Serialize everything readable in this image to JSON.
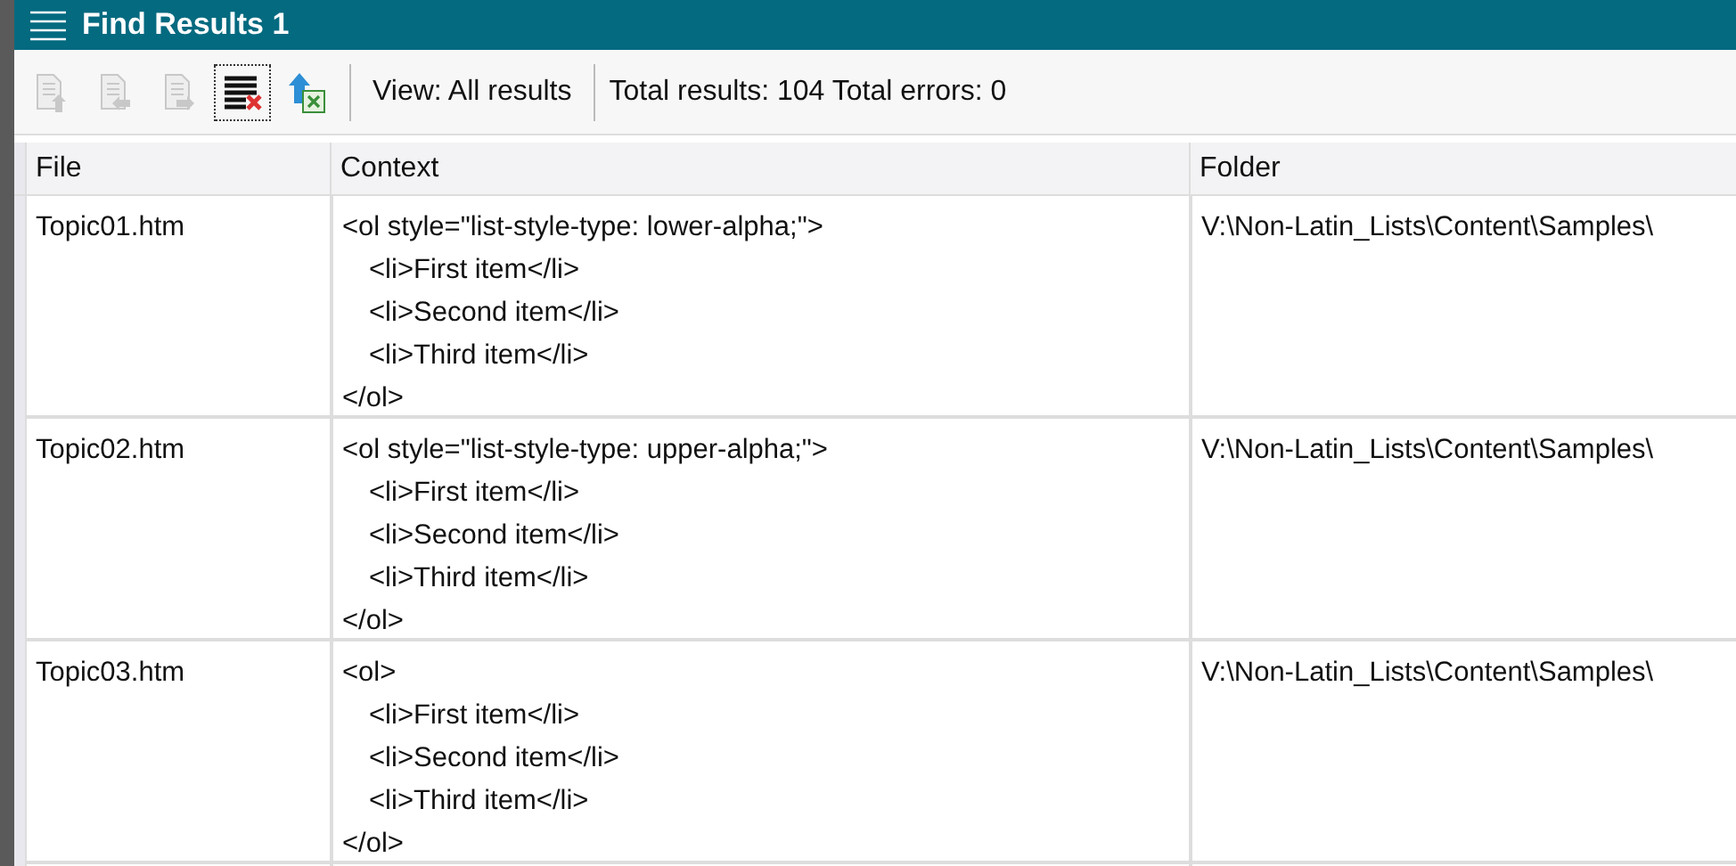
{
  "window": {
    "title": "Find Results 1"
  },
  "toolbar": {
    "buttons": [
      {
        "kind": "doc-up",
        "disabled": true,
        "focused": false
      },
      {
        "kind": "doc-left",
        "disabled": true,
        "focused": false
      },
      {
        "kind": "doc-right",
        "disabled": true,
        "focused": false
      },
      {
        "kind": "clear",
        "disabled": false,
        "focused": true
      },
      {
        "kind": "export",
        "disabled": false,
        "focused": false
      }
    ],
    "view": "View: All results",
    "summary": "Total results: 104 Total errors: 0"
  },
  "table": {
    "columns": [
      "File",
      "Context",
      "Folder"
    ],
    "rows": [
      {
        "file": "Topic01.htm",
        "context": {
          "open": "<ol style=\"list-style-type: lower-alpha;\">",
          "children": [
            "<li>First item</li>",
            "<li>Second item</li>",
            "<li>Third item</li>"
          ],
          "close": "</ol>"
        },
        "folder": "V:\\Non-Latin_Lists\\Content\\Samples\\"
      },
      {
        "file": "Topic02.htm",
        "context": {
          "open": "<ol style=\"list-style-type: upper-alpha;\">",
          "children": [
            "<li>First item</li>",
            "<li>Second item</li>",
            "<li>Third item</li>"
          ],
          "close": "</ol>"
        },
        "folder": "V:\\Non-Latin_Lists\\Content\\Samples\\"
      },
      {
        "file": "Topic03.htm",
        "context": {
          "open": "<ol>",
          "children": [
            "<li>First item</li>",
            "<li>Second item</li>",
            "<li>Third item</li>"
          ],
          "close": "</ol>"
        },
        "folder": "V:\\Non-Latin_Lists\\Content\\Samples\\"
      }
    ]
  }
}
